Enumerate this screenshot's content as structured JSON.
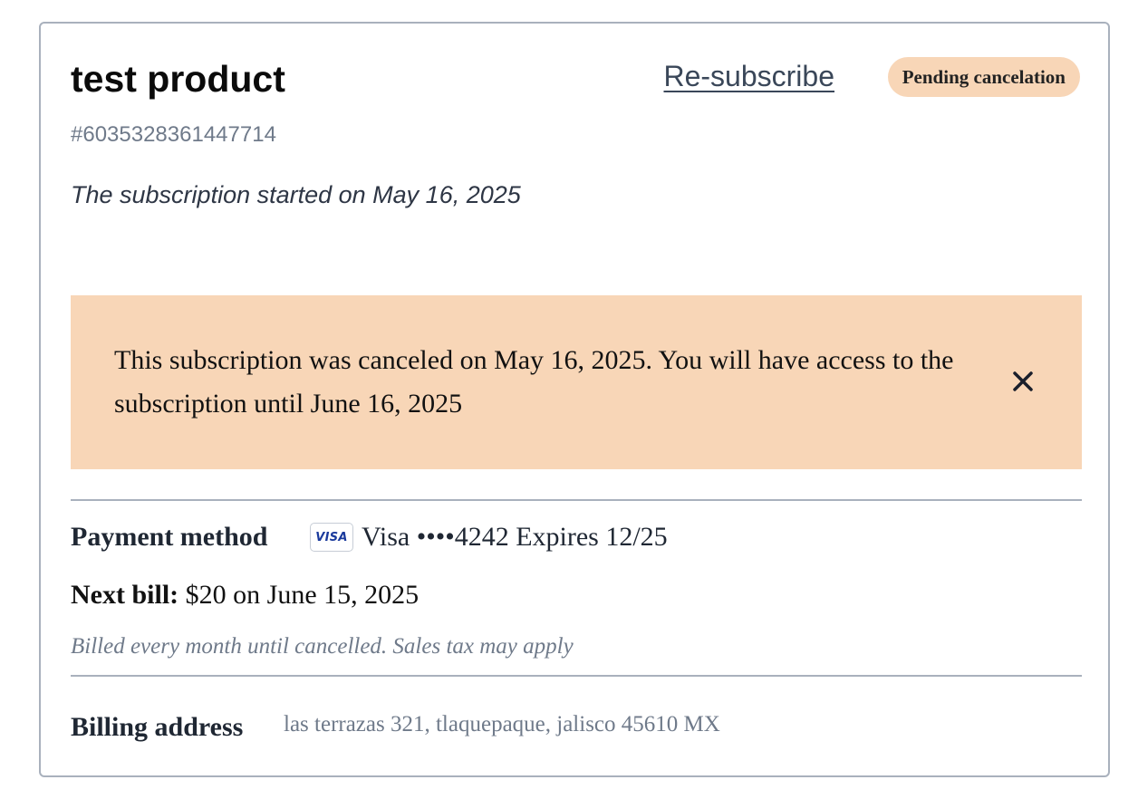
{
  "subscription": {
    "title": "test product",
    "id": "#6035328361447714",
    "started_text": "The subscription started on May 16, 2025",
    "resubscribe_label": "Re-subscribe",
    "status_badge": "Pending cancelation"
  },
  "alert": {
    "text": "This subscription was canceled on May 16, 2025. You will have access to the subscription until June 16, 2025",
    "close_icon": "close-icon",
    "background": "#f8d6b7"
  },
  "payment": {
    "label": "Payment method",
    "card_brand_icon": "VISA",
    "card_text": "Visa ••••4242 Expires 12/25"
  },
  "next_bill": {
    "label": "Next bill:",
    "value": " $20 on June 15, 2025",
    "note": "Billed every month until cancelled. Sales tax may apply"
  },
  "billing_address": {
    "label": "Billing address",
    "value": "las terrazas 321, tlaquepaque, jalisco 45610 MX"
  }
}
